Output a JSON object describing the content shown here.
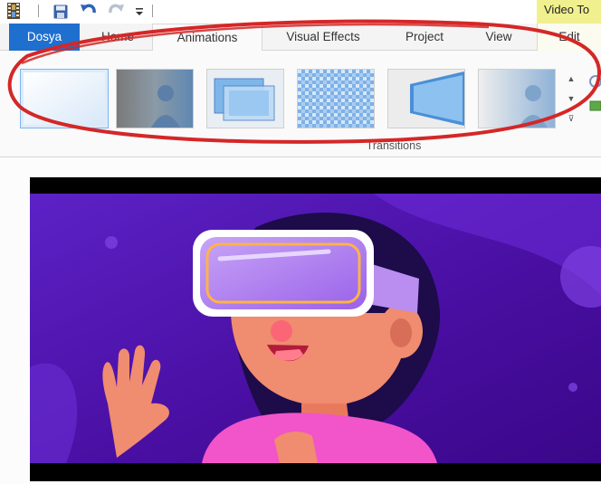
{
  "quick_access": {
    "icons": [
      "film-app-icon",
      "save-icon",
      "undo-icon",
      "redo-icon",
      "customize-dropdown-icon"
    ]
  },
  "contextual": {
    "label": "Video To"
  },
  "tabs": {
    "file": "Dosya",
    "home": "Home",
    "animations": "Animations",
    "visual_effects": "Visual Effects",
    "project": "Project",
    "view": "View",
    "edit": "Edit",
    "active": "Animations"
  },
  "ribbon": {
    "group_label": "Transitions",
    "transitions": [
      {
        "name": "No transition",
        "selected": true
      },
      {
        "name": "Crossfade"
      },
      {
        "name": "Cross-zoom"
      },
      {
        "name": "Dissolve"
      },
      {
        "name": "Flip"
      },
      {
        "name": "Fade"
      }
    ]
  },
  "annotation": {
    "shape": "ellipse",
    "color": "#d42727"
  },
  "colors": {
    "file_tab": "#1f6fcf",
    "contextual_tab": "#f1f08f",
    "selection": "#dcebfb"
  }
}
